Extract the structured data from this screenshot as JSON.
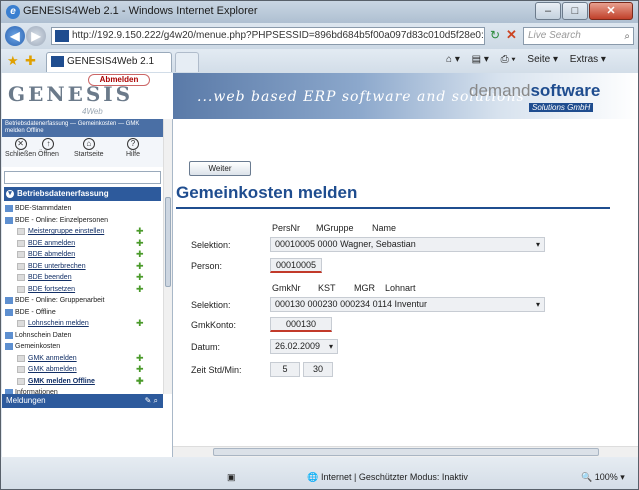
{
  "window": {
    "title": "GENESIS4Web 2.1 - Windows Internet Explorer",
    "address": "http://192.9.150.222/g4w20/menue.php?PHPSESSID=896bd684b5f00a097d83c010d5f28e0:",
    "search_placeholder": "Live Search",
    "tab_label": "GENESIS4Web 2.1",
    "commands": [
      "Seite ▾",
      "Extras ▾"
    ]
  },
  "header": {
    "logo": "GENESIS",
    "logo_sub": "4Web",
    "abmelden": "Abmelden",
    "slogan": "...web based ERP software and solutions",
    "brand_a": "demand",
    "brand_b": "software",
    "brand_sub": "Solutions GmbH"
  },
  "sidebar": {
    "breadcrumb": "Betriebsdatenerfassung — Gemeinkosten — GMK melden Offline",
    "tools": [
      "Schließen",
      "Öffnen",
      "Startseite",
      "Hilfe"
    ],
    "category": "Betriebsdatenerfassung",
    "tree": [
      {
        "label": "BDE-Stammdaten",
        "level": 0
      },
      {
        "label": "BDE - Online: Einzelpersonen",
        "level": 0
      },
      {
        "label": "Meistergruppe einstellen",
        "level": 1
      },
      {
        "label": "BDE anmelden",
        "level": 1
      },
      {
        "label": "BDE abmelden",
        "level": 1
      },
      {
        "label": "BDE unterbrechen",
        "level": 1
      },
      {
        "label": "BDE beenden",
        "level": 1
      },
      {
        "label": "BDE fortsetzen",
        "level": 1
      },
      {
        "label": "BDE - Online: Gruppenarbeit",
        "level": 0
      },
      {
        "label": "BDE - Offline",
        "level": 0
      },
      {
        "label": "Lohnschein melden",
        "level": 1
      },
      {
        "label": "Lohnschein Daten",
        "level": 0
      },
      {
        "label": "Gemeinkosten",
        "level": 0
      },
      {
        "label": "GMK anmelden",
        "level": 1
      },
      {
        "label": "GMK abmelden",
        "level": 1
      },
      {
        "label": "GMK melden Offline",
        "level": 1,
        "bold": true
      },
      {
        "label": "Informationen",
        "level": 0
      }
    ],
    "meldungen": "Meldungen"
  },
  "main": {
    "weiter": "Weiter",
    "title": "Gemeinkosten melden",
    "person_headers": [
      "PersNr",
      "MGruppe",
      "Name"
    ],
    "selektion_label": "Selektion:",
    "selektion1": "00010005  0000   Wagner, Sebastian",
    "person_label": "Person:",
    "person_value": "00010005",
    "gmk_headers": [
      "GmkNr",
      "KST",
      "MGR",
      "Lohnart"
    ],
    "selektion2": "000130  000230  000234  0114   Inventur",
    "gmkkonto_label": "GmkKonto:",
    "gmkkonto_value": "000130",
    "datum_label": "Datum:",
    "datum_value": "26.02.2009",
    "zeit_label": "Zeit   Std/Min:",
    "zeit_std": "5",
    "zeit_min": "30"
  },
  "status": {
    "zone": "Internet | Geschützter Modus: Inaktiv",
    "zoom": "100%"
  }
}
